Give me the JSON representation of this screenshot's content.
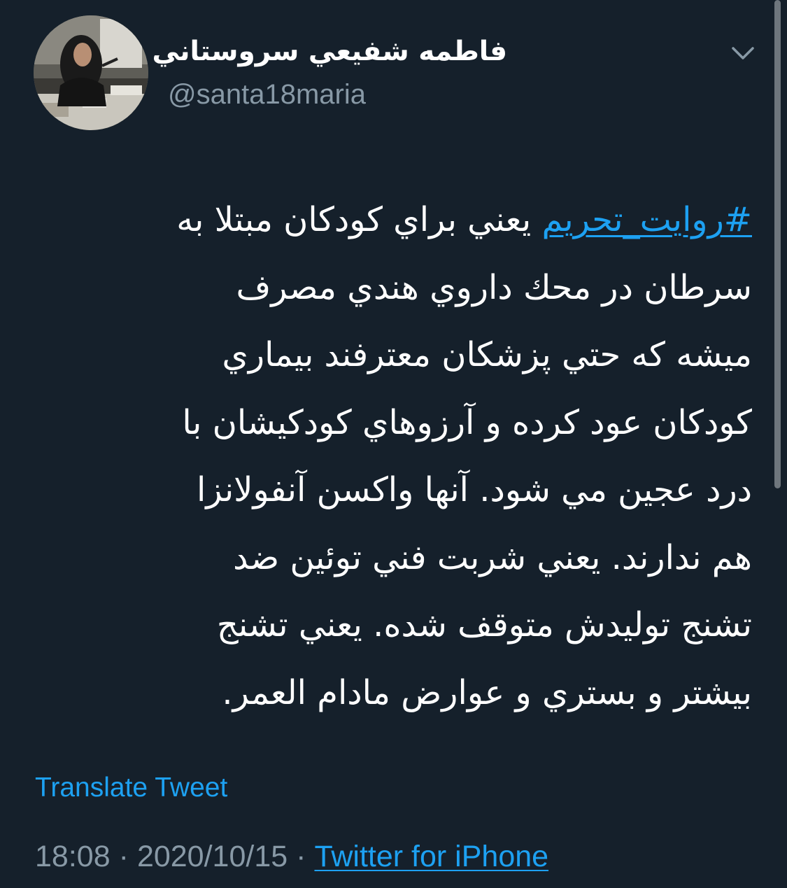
{
  "author": {
    "display_name": "فاطمه شفيعي سروستاني",
    "handle": "@santa18maria"
  },
  "tweet": {
    "hashtag": "#روايت_تحريم",
    "lines": [
      "يعني براي كودكان مبتلا به",
      "سرطان در محك داروي هندي مصرف",
      "ميشه كه حتي پزشكان معترفند بيماري",
      "كودكان عود كرده و آرزوهاي كودكيشان با",
      "درد عجين مي شود. آنها واكسن آنفولانزا",
      "هم ندارند. يعني شربت فني توئين ضد",
      "تشنج توليدش متوقف شده. يعني تشنج",
      "بيشتر و بستري و عوارض مادام العمر."
    ]
  },
  "actions": {
    "translate_label": "Translate Tweet"
  },
  "meta": {
    "time": "18:08",
    "date": "2020/10/15",
    "separator": "·",
    "source": "Twitter for iPhone"
  },
  "icons": {
    "menu": "chevron-down-icon"
  },
  "colors": {
    "background": "#15202b",
    "text": "#ffffff",
    "secondary_text": "#8899a6",
    "accent": "#1da1f2"
  }
}
